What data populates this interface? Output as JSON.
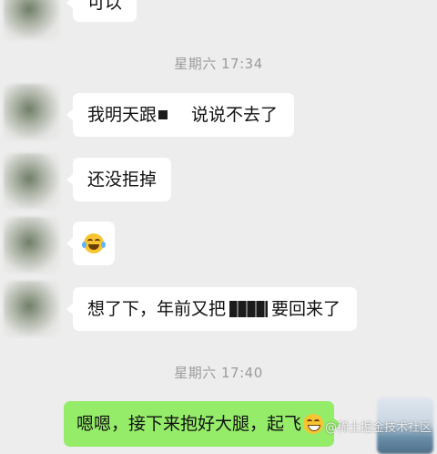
{
  "messages": {
    "partial_top": "可以",
    "m1_pre": "我明天跟",
    "m1_post": "说说不去了",
    "m2": "还没拒掉",
    "m4_pre": "想了下，年前又把",
    "m4_post": "要回来了",
    "m5": "嗯嗯，接下来抱好大腿，起飞"
  },
  "timestamps": {
    "t1": "星期六 17:34",
    "t2": "星期六 17:40"
  },
  "icons": {
    "laugh_emoji": "face-with-tears-of-joy-icon",
    "grin_emoji": "grinning-face-icon"
  },
  "colors": {
    "background": "#ededed",
    "incoming_bubble": "#ffffff",
    "outgoing_bubble": "#95ec69",
    "timestamp_text": "#9b9b9b"
  }
}
